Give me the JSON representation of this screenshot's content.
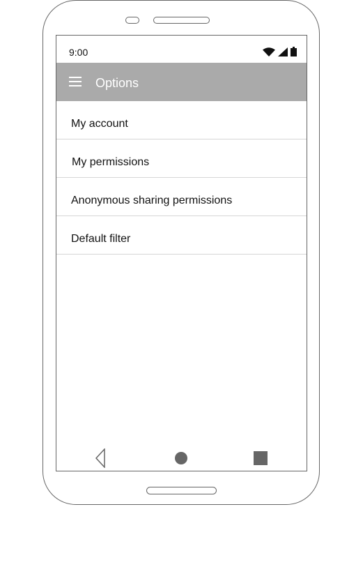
{
  "status_bar": {
    "time": "9:00",
    "icons": [
      "wifi-icon",
      "signal-icon",
      "battery-icon"
    ]
  },
  "app_bar": {
    "menu_icon": "menu-icon",
    "title": "Options"
  },
  "options": [
    {
      "label": "My account"
    },
    {
      "label": "My permissions"
    },
    {
      "label": "Anonymous sharing permissions"
    },
    {
      "label": "Default filter"
    }
  ],
  "nav_bar": {
    "icons": [
      "back-icon",
      "home-icon",
      "recent-apps-icon"
    ]
  },
  "colors": {
    "app_bar": "#aaaaaa",
    "app_title": "#ffffff",
    "outline": "#666666",
    "divider": "#d6d6d6"
  }
}
